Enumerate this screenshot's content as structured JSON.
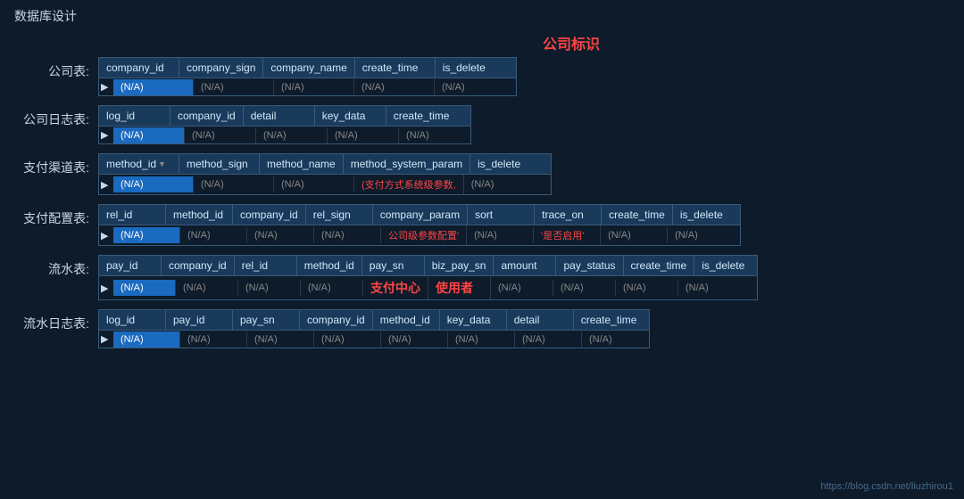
{
  "page": {
    "title": "数据库设计",
    "watermark": "https://blog.csdn.net/liuzhirou1"
  },
  "company_label": "公司标识",
  "tables": {
    "company": {
      "label": "公司表:",
      "headers": [
        "company_id",
        "company_sign",
        "company_name",
        "create_time",
        "is_delete"
      ],
      "row": [
        "(N/A)",
        "(N/A)",
        "(N/A)",
        "(N/A)",
        "(N/A)"
      ],
      "highlight": 0
    },
    "companyLog": {
      "label": "公司日志表:",
      "headers": [
        "log_id",
        "company_id",
        "detail",
        "key_data",
        "create_time"
      ],
      "row": [
        "(N/A)",
        "(N/A)",
        "(N/A)",
        "(N/A)",
        "(N/A)"
      ],
      "highlight": 0
    },
    "payMethod": {
      "label": "支付渠道表:",
      "headers": [
        "method_id",
        "method_sign",
        "method_name",
        "method_system_param",
        "is_delete"
      ],
      "headerDropdown": 0,
      "row": [
        "(N/A)",
        "(N/A)",
        "(N/A)",
        "(支付方式系统级参数,",
        "(N/A)"
      ],
      "highlight": 0,
      "redCells": [
        3
      ]
    },
    "payConfig": {
      "label": "支付配置表:",
      "headers": [
        "rel_id",
        "method_id",
        "company_id",
        "rel_sign",
        "company_param",
        "sort",
        "trace_on",
        "create_time",
        "is_delete"
      ],
      "row": [
        "(N/A)",
        "(N/A)",
        "(N/A)",
        "(N/A)",
        "公司级参数配置'",
        "(N/A)",
        "'是否启用'",
        "(N/A)",
        "(N/A)"
      ],
      "highlight": 0,
      "redCells": [
        4,
        6
      ]
    },
    "flow": {
      "label": "流水表:",
      "headers": [
        "pay_id",
        "company_id",
        "rel_id",
        "method_id",
        "pay_sn",
        "biz_pay_sn",
        "amount",
        "pay_status",
        "create_time",
        "is_delete"
      ],
      "row": [
        "(N/A)",
        "(N/A)",
        "(N/A)",
        "(N/A)",
        "支付中心",
        "使用者",
        "(N/A)",
        "(N/A)",
        "(N/A)",
        "(N/A)"
      ],
      "highlight": 0,
      "redCells": [
        4,
        5
      ]
    },
    "flowLog": {
      "label": "流水日志表:",
      "headers": [
        "log_id",
        "pay_id",
        "pay_sn",
        "company_id",
        "method_id",
        "key_data",
        "detail",
        "create_time"
      ],
      "row": [
        "(N/A)",
        "(N/A)",
        "(N/A)",
        "(N/A)",
        "(N/A)",
        "(N/A)",
        "(N/A)",
        "(N/A)"
      ],
      "highlight": 0
    }
  }
}
